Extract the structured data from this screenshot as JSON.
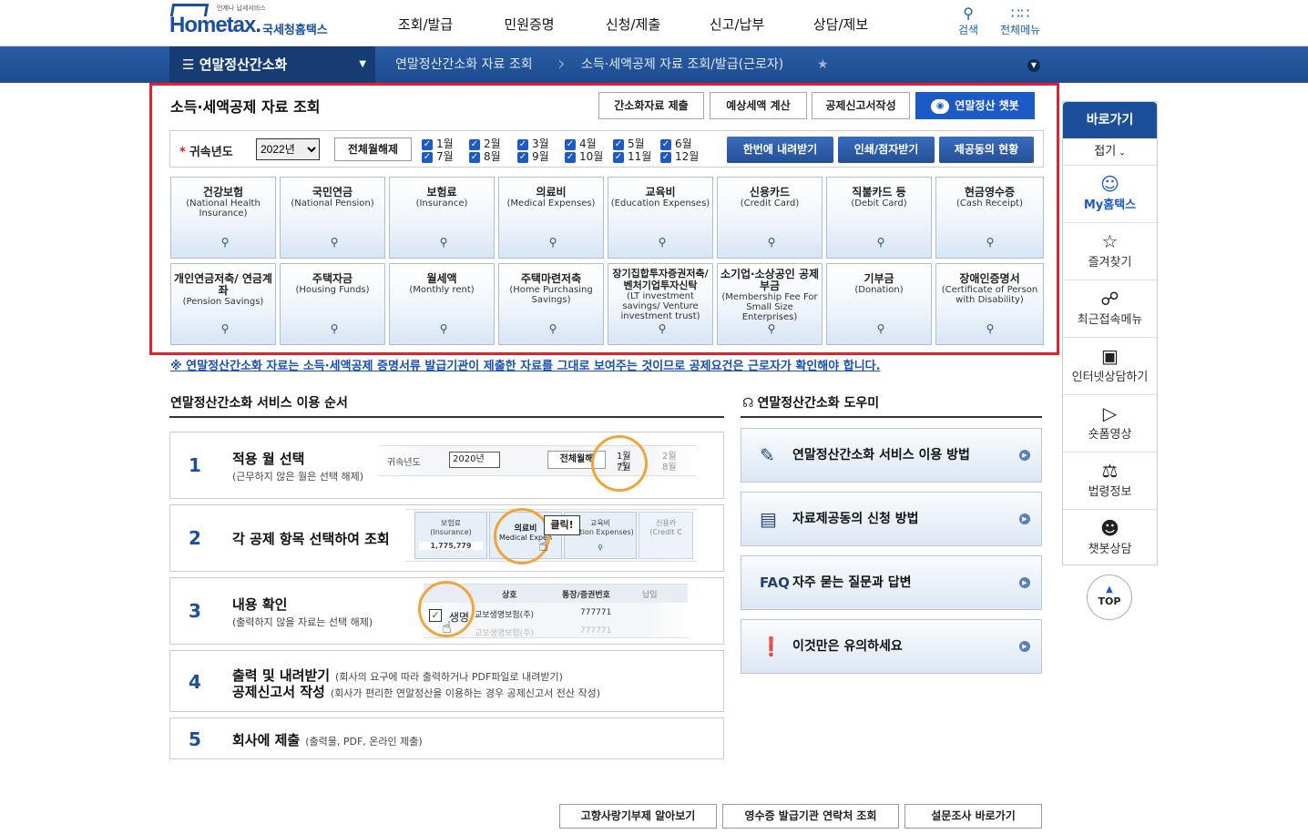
{
  "header": {
    "logo_small": "언제나 납세서비스",
    "logo_main": "Hometax.",
    "logo_sub": "국세청홈택스",
    "menu": [
      "조회/발급",
      "민원증명",
      "신청/제출",
      "신고/납부",
      "상담/제보"
    ],
    "search_label": "검색",
    "allmenu_label": "전체메뉴"
  },
  "nav": {
    "current": "연말정산간소화",
    "crumb1": "연말정산간소화 자료 조회",
    "crumb2": "소득·세액공제 자료 조회/발급(근로자)"
  },
  "main": {
    "title": "소득·세액공제 자료 조회",
    "buttons": [
      "간소화자료 제출",
      "예상세액 계산",
      "공제신고서작성",
      "연말정산 챗봇"
    ],
    "filter": {
      "label": "귀속년도",
      "year": "2022년",
      "reset": "전체월해제",
      "months": [
        "1월",
        "2월",
        "3월",
        "4월",
        "5월",
        "6월",
        "7월",
        "8월",
        "9월",
        "10월",
        "11월",
        "12월"
      ],
      "actions": [
        "한번에 내려받기",
        "인쇄/점자받기",
        "제공동의 현황"
      ]
    },
    "tiles": [
      {
        "t": "건강보험",
        "e": "(National Health Insurance)"
      },
      {
        "t": "국민연금",
        "e": "(National Pension)"
      },
      {
        "t": "보험료",
        "e": "(Insurance)"
      },
      {
        "t": "의료비",
        "e": "(Medical Expenses)"
      },
      {
        "t": "교육비",
        "e": "(Education Expenses)"
      },
      {
        "t": "신용카드",
        "e": "(Credit Card)"
      },
      {
        "t": "직불카드 등",
        "e": "(Debit Card)"
      },
      {
        "t": "현금영수증",
        "e": "(Cash Receipt)"
      },
      {
        "t": "개인연금저축/ 연금계좌",
        "e": "(Pension Savings)"
      },
      {
        "t": "주택자금",
        "e": "(Housing Funds)"
      },
      {
        "t": "월세액",
        "e": "(Monthly rent)"
      },
      {
        "t": "주택마련저축",
        "e": "(Home Purchasing Savings)"
      },
      {
        "t": "장기집합투자증권저축/ 벤처기업투자신탁",
        "e": "(LT investment savings/ Venture investment trust)"
      },
      {
        "t": "소기업·소상공인 공제부금",
        "e": "(Membership Fee For Small Size Enterprises)"
      },
      {
        "t": "기부금",
        "e": "(Donation)"
      },
      {
        "t": "장애인증명서",
        "e": "(Certificate of Person with Disability)"
      }
    ],
    "notice": "※ 연말정산간소화 자료는 소득·세액공제 증명서류 발급기관이 제출한 자료를 그대로 보여주는 것이므로 공제요건은 근로자가 확인해야 합니다."
  },
  "steps": {
    "title": "연말정산간소화 서비스 이용 순서",
    "items": [
      {
        "n": "1",
        "t": "적용 월 선택",
        "d": "(근무하지 않은 월은 선택 해제)"
      },
      {
        "n": "2",
        "t": "각 공제 항목 선택하여 조회",
        "d": ""
      },
      {
        "n": "3",
        "t": "내용 확인",
        "d": "(출력하지 않을 자료는 선택 해제)"
      },
      {
        "n": "4",
        "t": "출력 및 내려받기",
        "d": "(회사의 요구에 따라 출력하거나 PDF파일로 내려받기)",
        "t2": "공제신고서 작성",
        "d2": "(회사가 편리한 연말정산을 이용하는 경우 공제신고서 전산 작성)"
      },
      {
        "n": "5",
        "t": "회사에 제출",
        "d": "(출력물, PDF, 온라인 제출)"
      }
    ],
    "mock1": {
      "label": "귀속년도",
      "year": "2020년",
      "reset": "전체월해",
      "m1": "1월",
      "m2": "2월",
      "m7": "7월",
      "m8": "8월"
    },
    "mock2": {
      "ins": "보험료",
      "ins_e": "(Insurance)",
      "ins_v": "1,775,779",
      "med": "의료비",
      "med_e": "Medical Expen",
      "edu": "교육비",
      "edu_e": "ucation Expenses)",
      "card": "신용카",
      "card_e": "(Credit C",
      "click": "클릭!"
    },
    "mock3": {
      "h1": "상호",
      "h2": "통장/증권번호",
      "h3": "납입",
      "r1": "교보생명보험(주)",
      "r1v": "777771",
      "r2": "교보생명보험(주)",
      "r2v": "777771",
      "life": "생명"
    }
  },
  "helper": {
    "title": "연말정산간소화 도우미",
    "items": [
      "연말정산간소화 서비스 이용 방법",
      "자료제공동의 신청 방법",
      "자주 묻는 질문과 답변",
      "이것만은 유의하세요"
    ],
    "faq": "FAQ"
  },
  "quick": {
    "title": "바로가기",
    "fold": "접기",
    "items": [
      "My홈택스",
      "즐겨찾기",
      "최근접속메뉴",
      "인터넷상담하기",
      "숏폼영상",
      "법령정보",
      "챗봇상담"
    ],
    "top": "TOP"
  },
  "bottom": [
    "고향사랑기부제 알아보기",
    "영수증 발급기관 연락처 조회",
    "설문조사 바로가기"
  ]
}
